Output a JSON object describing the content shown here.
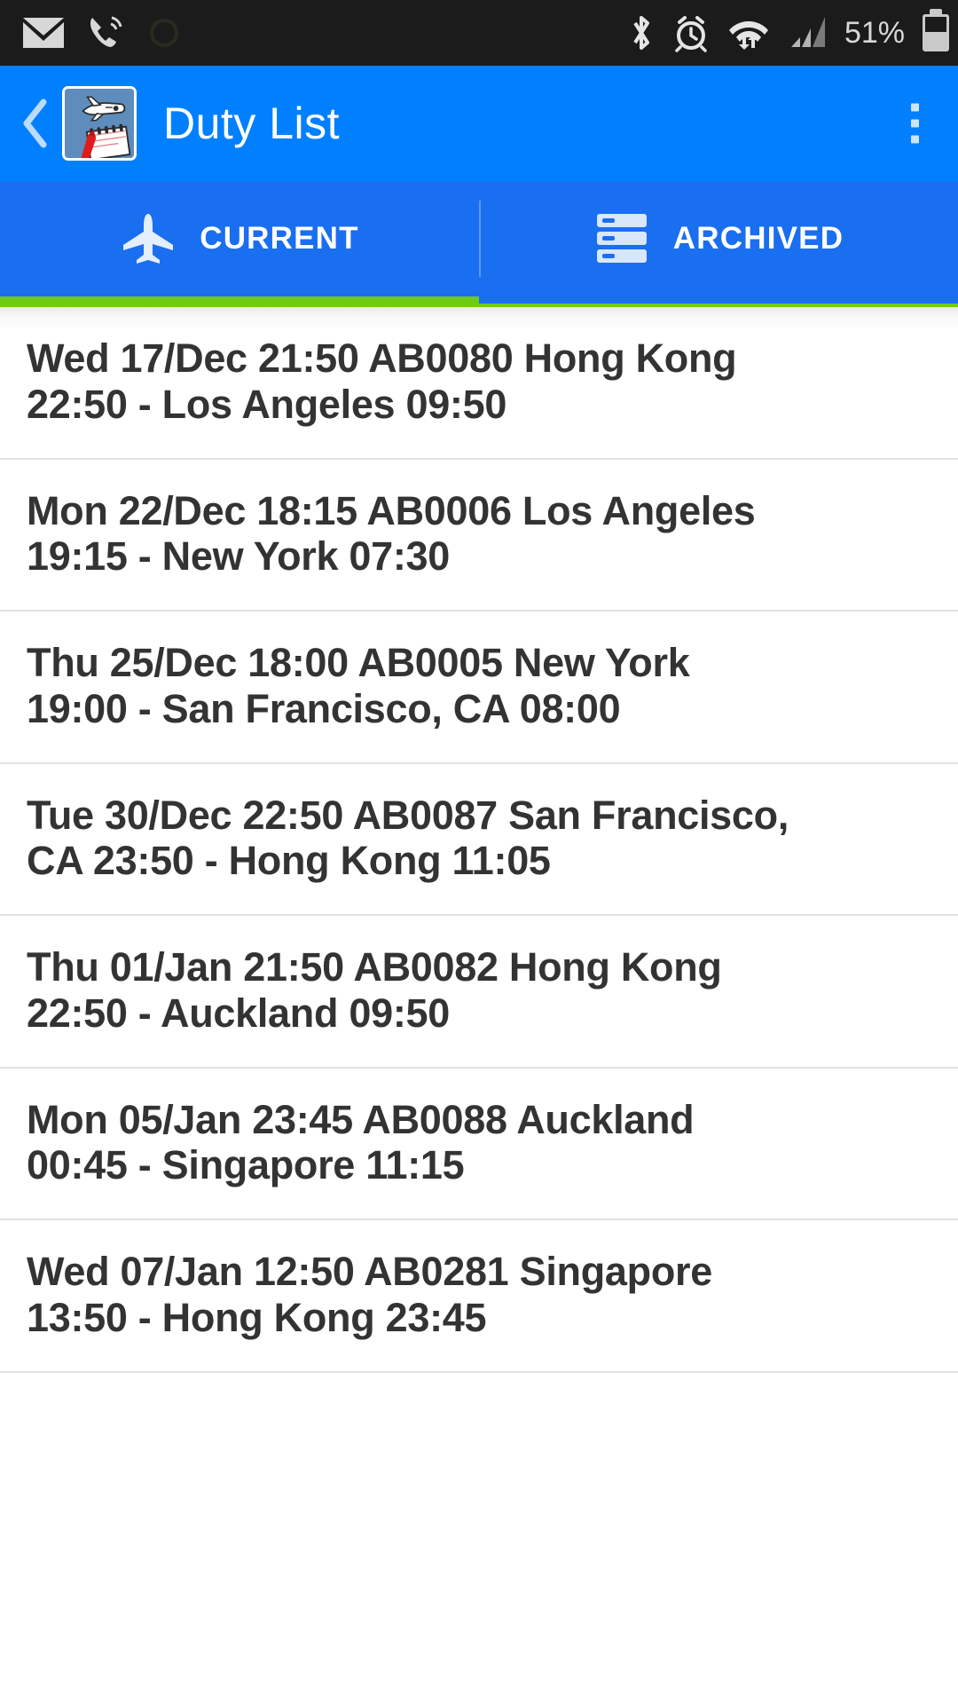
{
  "status_bar": {
    "icons": [
      "mail-icon",
      "phone-call-icon",
      "bluetooth-icon",
      "alarm-clock-icon",
      "wifi-data-icon",
      "cell-signal-icon"
    ],
    "battery_percent": "51%"
  },
  "app_bar": {
    "back_label": "‹",
    "title": "Duty List",
    "app_icon_name": "airplane-notepad-icon",
    "overflow_label": "More options"
  },
  "tabs": [
    {
      "label": "CURRENT",
      "icon": "airplane-icon",
      "active": true
    },
    {
      "label": "ARCHIVED",
      "icon": "archive-stack-icon",
      "active": false
    }
  ],
  "colors": {
    "app_bar_blue": "#0080ff",
    "tab_bar_blue": "#1a6ef0",
    "indicator_green": "#6ecb1a",
    "text_dark": "#333333",
    "status_bar_dark": "#1b1b1b"
  },
  "duties": [
    {
      "line1": "Wed 17/Dec 21:50 AB0080 Hong Kong",
      "line2": "22:50 - Los Angeles 09:50"
    },
    {
      "line1": "Mon 22/Dec 18:15 AB0006 Los Angeles",
      "line2": "19:15 - New York 07:30"
    },
    {
      "line1": "Thu 25/Dec 18:00 AB0005 New York",
      "line2": "19:00 - San Francisco, CA 08:00"
    },
    {
      "line1": "Tue 30/Dec 22:50 AB0087 San Francisco,",
      "line2": "CA 23:50 - Hong Kong 11:05"
    },
    {
      "line1": "Thu 01/Jan 21:50 AB0082 Hong Kong",
      "line2": "22:50 - Auckland 09:50"
    },
    {
      "line1": "Mon 05/Jan 23:45 AB0088 Auckland",
      "line2": "00:45 - Singapore 11:15"
    },
    {
      "line1": "Wed 07/Jan 12:50 AB0281 Singapore",
      "line2": "13:50 - Hong Kong 23:45"
    }
  ]
}
